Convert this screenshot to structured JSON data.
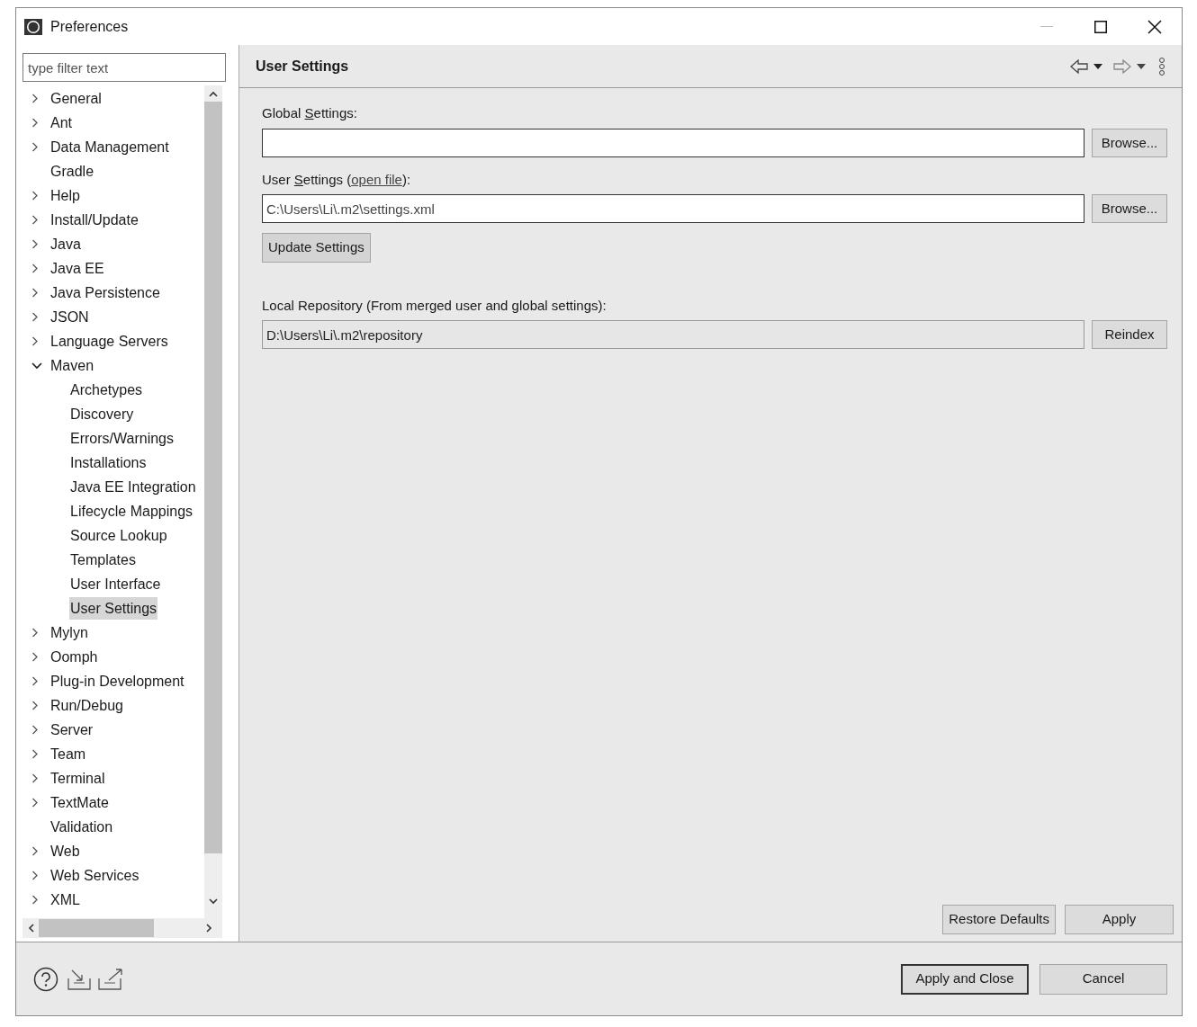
{
  "window": {
    "title": "Preferences"
  },
  "filter": {
    "placeholder": "type filter text"
  },
  "tree": [
    {
      "label": "General",
      "kind": "branch",
      "expanded": false,
      "selected": false
    },
    {
      "label": "Ant",
      "kind": "branch",
      "expanded": false,
      "selected": false
    },
    {
      "label": "Data Management",
      "kind": "branch",
      "expanded": false,
      "selected": false
    },
    {
      "label": "Gradle",
      "kind": "leaf",
      "selected": false
    },
    {
      "label": "Help",
      "kind": "branch",
      "expanded": false,
      "selected": false
    },
    {
      "label": "Install/Update",
      "kind": "branch",
      "expanded": false,
      "selected": false
    },
    {
      "label": "Java",
      "kind": "branch",
      "expanded": false,
      "selected": false
    },
    {
      "label": "Java EE",
      "kind": "branch",
      "expanded": false,
      "selected": false
    },
    {
      "label": "Java Persistence",
      "kind": "branch",
      "expanded": false,
      "selected": false
    },
    {
      "label": "JSON",
      "kind": "branch",
      "expanded": false,
      "selected": false
    },
    {
      "label": "Language Servers",
      "kind": "branch",
      "expanded": false,
      "selected": false
    },
    {
      "label": "Maven",
      "kind": "branch",
      "expanded": true,
      "selected": false,
      "children": [
        {
          "label": "Archetypes",
          "kind": "leaf",
          "selected": false
        },
        {
          "label": "Discovery",
          "kind": "leaf",
          "selected": false
        },
        {
          "label": "Errors/Warnings",
          "kind": "leaf",
          "selected": false
        },
        {
          "label": "Installations",
          "kind": "leaf",
          "selected": false
        },
        {
          "label": "Java EE Integration",
          "kind": "leaf",
          "selected": false
        },
        {
          "label": "Lifecycle Mappings",
          "kind": "leaf",
          "selected": false
        },
        {
          "label": "Source Lookup",
          "kind": "leaf",
          "selected": false
        },
        {
          "label": "Templates",
          "kind": "leaf",
          "selected": false
        },
        {
          "label": "User Interface",
          "kind": "leaf",
          "selected": false
        },
        {
          "label": "User Settings",
          "kind": "leaf",
          "selected": true
        }
      ]
    },
    {
      "label": "Mylyn",
      "kind": "branch",
      "expanded": false,
      "selected": false
    },
    {
      "label": "Oomph",
      "kind": "branch",
      "expanded": false,
      "selected": false
    },
    {
      "label": "Plug-in Development",
      "kind": "branch",
      "expanded": false,
      "selected": false
    },
    {
      "label": "Run/Debug",
      "kind": "branch",
      "expanded": false,
      "selected": false
    },
    {
      "label": "Server",
      "kind": "branch",
      "expanded": false,
      "selected": false
    },
    {
      "label": "Team",
      "kind": "branch",
      "expanded": false,
      "selected": false
    },
    {
      "label": "Terminal",
      "kind": "branch",
      "expanded": false,
      "selected": false
    },
    {
      "label": "TextMate",
      "kind": "branch",
      "expanded": false,
      "selected": false
    },
    {
      "label": "Validation",
      "kind": "leaf",
      "selected": false
    },
    {
      "label": "Web",
      "kind": "branch",
      "expanded": false,
      "selected": false
    },
    {
      "label": "Web Services",
      "kind": "branch",
      "expanded": false,
      "selected": false
    },
    {
      "label": "XML",
      "kind": "branch",
      "expanded": false,
      "selected": false
    }
  ],
  "page": {
    "title": "User Settings",
    "global_settings": {
      "before": "Global ",
      "mnemonic": "S",
      "after": "ettings:",
      "button": "Browse..."
    },
    "user_settings": {
      "before": "User ",
      "mnemonic": "S",
      "after": "ettings (",
      "link": "open file",
      "end": "):",
      "value": "C:\\Users\\Li\\.m2\\settings.xml",
      "button": "Browse..."
    },
    "update_button": "Update Settings",
    "local_repository": {
      "label": "Local Repository (From merged user and global settings):",
      "value": "D:\\Users\\Li\\.m2\\repository",
      "disabled": true,
      "button": "Reindex"
    },
    "buttons": [
      "Restore Defaults",
      "Apply"
    ]
  },
  "footer_buttons": [
    {
      "label": "Apply and Close",
      "default": true
    },
    {
      "label": "Cancel",
      "default": false
    }
  ]
}
